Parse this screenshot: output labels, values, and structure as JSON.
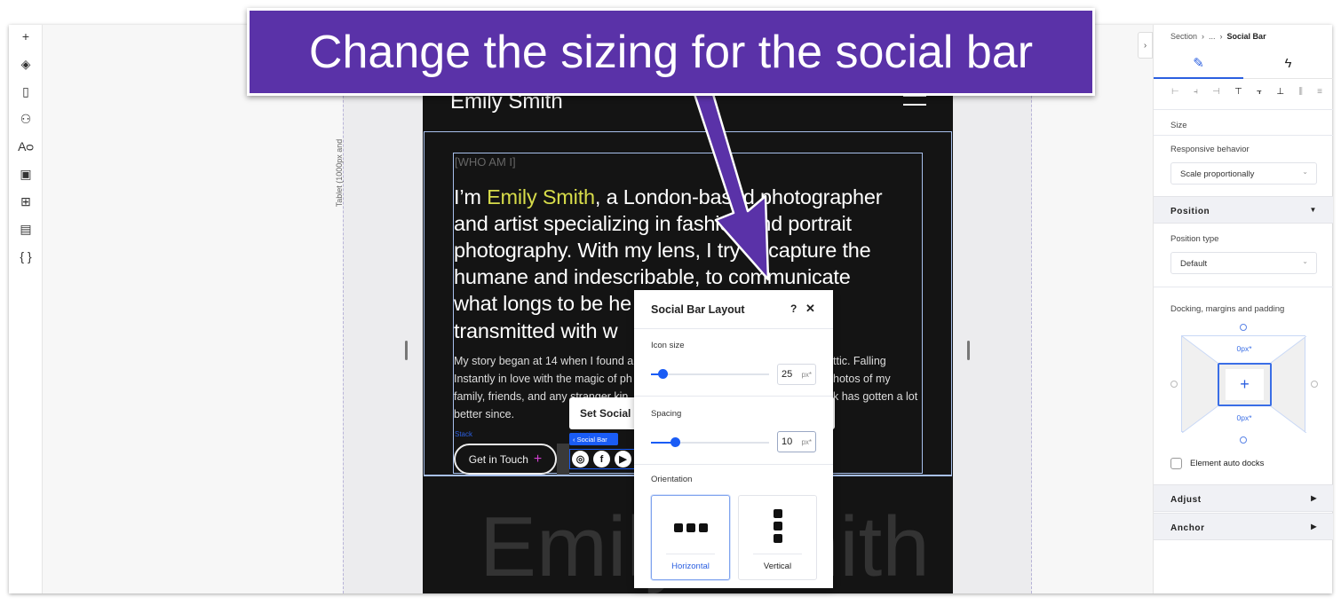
{
  "callout": {
    "text": "Change the sizing for the social bar",
    "color": "#5a32a8"
  },
  "left_toolbar": {
    "icons": [
      "plus-icon",
      "layers-icon",
      "page-icon",
      "connections-icon",
      "typography-icon",
      "media-icon",
      "apps-icon",
      "table-icon",
      "code-icon"
    ],
    "glyphs": [
      "+",
      "◈",
      "▯",
      "⚇",
      "Aᴑ",
      "▣",
      "⊞",
      "▤",
      "{ }"
    ]
  },
  "canvas": {
    "breakpoint_label": "Tablet (1000px and"
  },
  "site": {
    "name": "Emily Smith",
    "who": "[WHO AM I]",
    "headline_pre": "I’m ",
    "headline_name": "Emily Smith",
    "headline_lines": [
      ", a London-based photographer",
      "and artist specializing in fashion and portrait",
      "photography. With my lens, I try to capture the",
      "humane and indescribable, to communicate",
      "what longs to be he",
      "transmitted with w"
    ],
    "body_left": [
      "My story began at 14 when I found a",
      "Instantly in love with the magic of ph",
      "family, friends, and any stranger kin",
      "better since."
    ],
    "body_right": [
      "ttic. Falling",
      "hotos of my",
      "k has gotten a lot",
      ""
    ],
    "stack_label": "Stack",
    "cta": "Get in Touch",
    "cta_plus": "+",
    "footer_name": "Emily Smith",
    "accent": "#d7dc4a"
  },
  "tooltip": "Set Social L",
  "social_bar": {
    "label": "‹ Social Bar",
    "icons": [
      {
        "name": "instagram-icon",
        "glyph": "◎"
      },
      {
        "name": "facebook-icon",
        "glyph": "f"
      },
      {
        "name": "youtube-icon",
        "glyph": "▶"
      }
    ]
  },
  "popup": {
    "title": "Social Bar Layout",
    "help": "?",
    "close": "✕",
    "icon_size": {
      "label": "Icon size",
      "value": "25",
      "unit": "px*",
      "fraction": 0.1
    },
    "spacing": {
      "label": "Spacing",
      "value": "10",
      "unit": "px*",
      "fraction": 0.2
    },
    "orientation": {
      "label": "Orientation",
      "options": [
        "Horizontal",
        "Vertical"
      ],
      "selected": "Horizontal"
    }
  },
  "right_panel": {
    "breadcrumb": [
      "Section",
      "...",
      "Social Bar"
    ],
    "tabs": [
      "design-icon",
      "interactions-icon"
    ],
    "size_label": "Size",
    "responsive_label": "Responsive behavior",
    "responsive_value": "Scale proportionally",
    "position_header": "Position",
    "position_type_label": "Position type",
    "position_type_value": "Default",
    "docking_label": "Docking, margins and padding",
    "dock_top": "0px*",
    "dock_bottom": "0px*",
    "auto_docks_label": "Element auto docks",
    "adjust_header": "Adjust",
    "anchor_header": "Anchor",
    "accent": "#2b5fe0"
  }
}
